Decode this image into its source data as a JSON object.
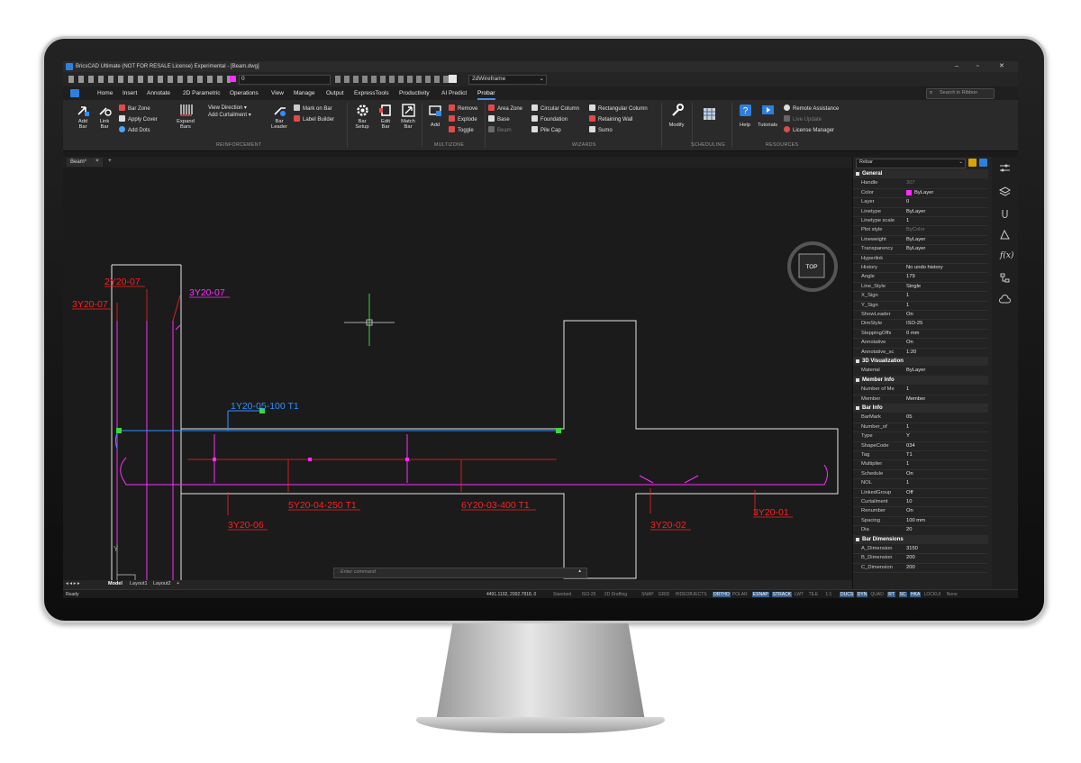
{
  "window": {
    "title": "BricsCAD Ultimate (NOT FOR RESALE License) Experimental - [Beam.dwg]",
    "layer_value": "0",
    "visual_style": "2dWireframe"
  },
  "menu": [
    "Home",
    "Insert",
    "Annotate",
    "2D Parametric",
    "Operations",
    "View",
    "Manage",
    "Output",
    "ExpressTools",
    "Productivity",
    "AI Predict",
    "Probar"
  ],
  "search_placeholder": "Search in Ribbon",
  "ribbon": {
    "add_bar": "Add\nBar",
    "link_bar": "Link\nBar",
    "bar_zone": "Bar Zone",
    "apply_cover": "Apply Cover",
    "add_dots": "Add Dots",
    "expand_bars": "Expand\nBars",
    "view_direction": "View Direction",
    "add_curtailment": "Add Curtailment",
    "bar_leader": "Bar\nLeader",
    "mark_on_bar": "Mark on Bar",
    "label_builder": "Label Builder",
    "bar_setup": "Bar\nSetup",
    "edit_bar": "Edit\nBar",
    "match_bar": "Match\nBar",
    "add": "Add",
    "remove": "Remove",
    "explode": "Explode",
    "toggle": "Toggle",
    "area_zone": "Area Zone",
    "base": "Base",
    "beam": "Beam",
    "circular_column": "Circular Column",
    "foundation": "Foundation",
    "pile_cap": "Pile Cap",
    "rectangular_column": "Rectangular Column",
    "retaining_wall": "Retaining Wall",
    "sumo": "Sumo",
    "modify": "Modify",
    "help": "Help",
    "tutorials": "Tutorials",
    "remote_assistance": "Remote Assistance",
    "live_update": "Live Update",
    "license_manager": "License Manager",
    "groups": {
      "reinforcement": "REINFORCEMENT",
      "multizone": "MULTIZONE",
      "wizards": "WIZARDS",
      "scheduling": "SCHEDULING",
      "resources": "RESOURCES"
    }
  },
  "doc_tab": "Beam*",
  "viewcube_label": "TOP",
  "cad_labels": {
    "l1": "2Y20-07",
    "l2": "3Y20-07",
    "l3": "3Y20-07",
    "l4": "1Y20-05-100 T1",
    "l5": "5Y20-04-250 T1",
    "l6": "6Y20-03-400 T1",
    "l7": "3Y20-06",
    "l8": "3Y20-02",
    "l9": "3Y20-01"
  },
  "ucs": {
    "w": "W",
    "x": "X",
    "y": "Y"
  },
  "command_placeholder": ": Enter command",
  "layout_tabs": [
    "Model",
    "Layout1",
    "Layout2"
  ],
  "status": {
    "ready": "Ready",
    "coords": "4491.1102, 2002.7818, 0",
    "items": [
      "Standard",
      "ISO-25",
      "2D Drafting",
      "SNAP",
      "GRID",
      "HIDEOBJECTS",
      "ORTHO",
      "POLAR",
      "ESNAP",
      "STRACK",
      "LWT",
      "TILE",
      "1:1",
      "DUCS",
      "DYN",
      "QUAD",
      "RT",
      "SC",
      "HKA",
      "LOCKUI",
      "None"
    ]
  },
  "panel": {
    "selector": "Rebar",
    "sections": [
      {
        "name": "General",
        "rows": [
          [
            "Handle",
            "307"
          ],
          [
            "Color",
            "ByLayer"
          ],
          [
            "Layer",
            "0"
          ],
          [
            "Linetype",
            "ByLayer"
          ],
          [
            "Linetype scale",
            "1"
          ],
          [
            "Plot style",
            "ByColor"
          ],
          [
            "Lineweight",
            "ByLayer"
          ],
          [
            "Transparency",
            "ByLayer"
          ],
          [
            "Hyperlink",
            ""
          ],
          [
            "History",
            "No undo history"
          ],
          [
            "Angle",
            "179"
          ],
          [
            "Line_Style",
            "Single"
          ],
          [
            "X_Sign",
            "1"
          ],
          [
            "Y_Sign",
            "1"
          ],
          [
            "ShowLeader",
            "On"
          ],
          [
            "DimStyle",
            "ISO-25"
          ],
          [
            "SteppingOffs",
            "0 mm"
          ],
          [
            "Annotative",
            "On"
          ],
          [
            "Annotative_sc",
            "1:20"
          ]
        ]
      },
      {
        "name": "3D Visualization",
        "rows": [
          [
            "Material",
            "ByLayer"
          ]
        ]
      },
      {
        "name": "Member Info",
        "rows": [
          [
            "Number of Me",
            "1"
          ],
          [
            "Member",
            "Member"
          ]
        ]
      },
      {
        "name": "Bar Info",
        "rows": [
          [
            "BarMark",
            "05"
          ],
          [
            "Number_of",
            "1"
          ],
          [
            "Type",
            "Y"
          ],
          [
            "ShapeCode",
            "034"
          ],
          [
            "Tag",
            "T1"
          ],
          [
            "Multiplier",
            "1"
          ],
          [
            "Schedule",
            "On"
          ],
          [
            "NOL",
            "1"
          ],
          [
            "LinkedGroup",
            "Off"
          ],
          [
            "Curtailment",
            "10"
          ],
          [
            "Renumber",
            "On"
          ],
          [
            "Spacing",
            "100 mm"
          ],
          [
            "Dia",
            "20"
          ]
        ]
      },
      {
        "name": "Bar Dimensions",
        "rows": [
          [
            "A_Dimension",
            "3150"
          ],
          [
            "B_Dimension",
            "200"
          ],
          [
            "C_Dimension",
            "200"
          ]
        ]
      }
    ]
  },
  "colors": {
    "red": "#ff2020",
    "magenta": "#ff2dff",
    "blue": "#2f8fff",
    "accent": "#4a90e2"
  }
}
